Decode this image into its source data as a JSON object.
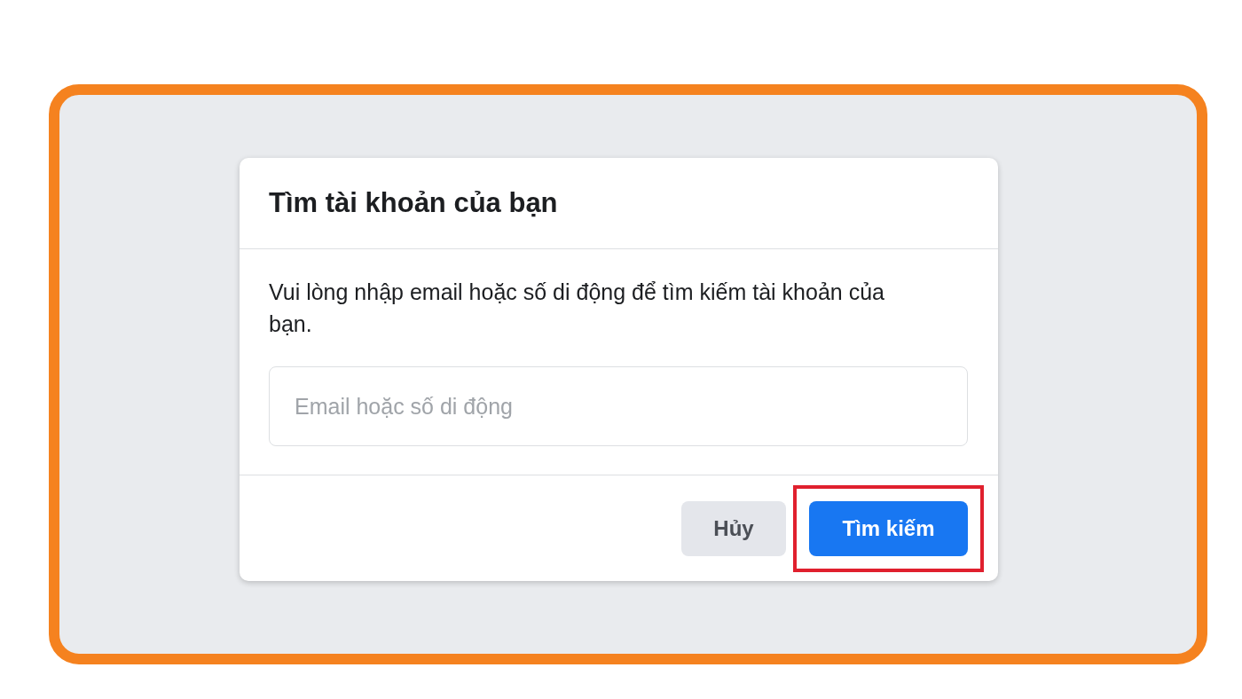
{
  "dialog": {
    "title": "Tìm tài khoản của bạn",
    "description": "Vui lòng nhập email hoặc số di động để tìm kiếm tài khoản của bạn.",
    "input": {
      "placeholder": "Email hoặc số di động"
    },
    "buttons": [
      {
        "label": "Hủy",
        "kind": "secondary",
        "highlighted": false
      },
      {
        "label": "Tìm kiếm",
        "kind": "primary",
        "highlighted": true
      }
    ]
  }
}
